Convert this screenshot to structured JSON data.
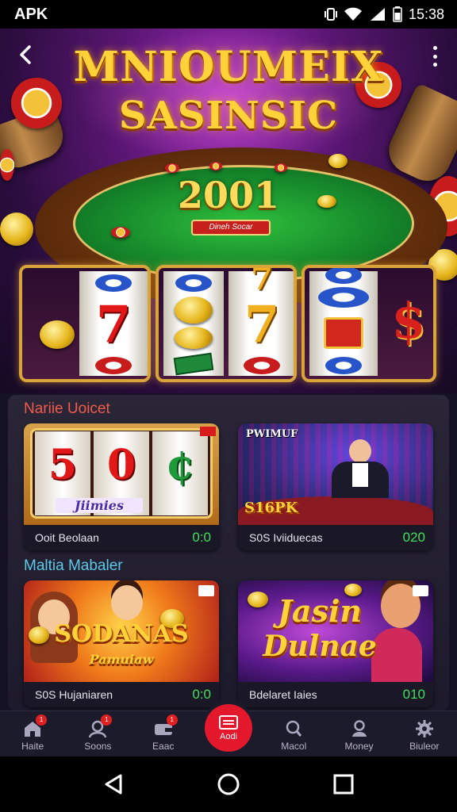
{
  "status_bar": {
    "carrier": "APK",
    "time": "15:38"
  },
  "hero": {
    "title_line1": "MNIOUMEIX",
    "title_line2": "SASINSIC",
    "table_year": "2001",
    "table_plate": "Dineh Socar"
  },
  "sections": [
    {
      "title": "Nariie Uoicet",
      "cards": [
        {
          "name": "Ooit Beolaan",
          "value": "0:0",
          "art_text": "Jiimies"
        },
        {
          "name": "S0S Iviiduecas",
          "value": "020",
          "art_text": "S16PK",
          "art_top": "PWIMUF"
        }
      ]
    },
    {
      "title": "Maltia Mabaler",
      "cards": [
        {
          "name": "S0S Hujaniaren",
          "value": "0:0",
          "art_text": "SODANAS",
          "art_sub": "Pamuiaw"
        },
        {
          "name": "Bdelaret Iaies",
          "value": "010",
          "art_text": "Jasin",
          "art_text2": "Dulnae"
        }
      ]
    }
  ],
  "bottom_nav": [
    {
      "label": "Haite",
      "icon": "home-icon",
      "badge": "1"
    },
    {
      "label": "Soons",
      "icon": "user-icon",
      "badge": "1"
    },
    {
      "label": "Eaac",
      "icon": "wallet-icon",
      "badge": "1"
    },
    {
      "label": "Aodi",
      "icon": "menu-icon",
      "center": true
    },
    {
      "label": "Macol",
      "icon": "search-icon"
    },
    {
      "label": "Money",
      "icon": "person-icon"
    },
    {
      "label": "Biuleor",
      "icon": "gear-icon"
    }
  ],
  "colors": {
    "accent": "#e3182d",
    "section1": "#f25a4a",
    "section2": "#5fc8e8",
    "value": "#3ee05a"
  }
}
